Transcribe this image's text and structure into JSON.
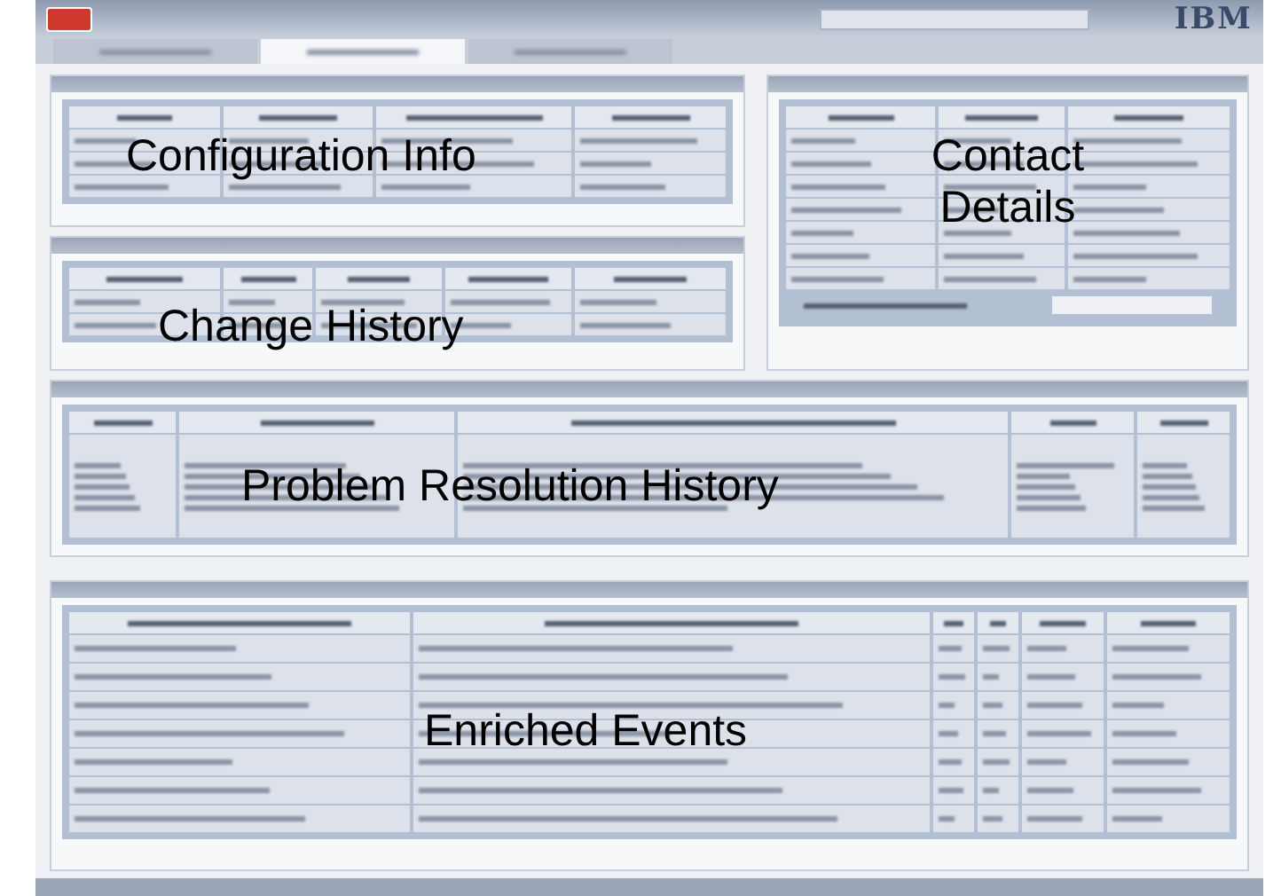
{
  "header": {
    "brand": "IBM"
  },
  "tabs": [
    {
      "selected": false
    },
    {
      "selected": true
    },
    {
      "selected": false
    }
  ],
  "panels": [
    {
      "kind": "config",
      "label": "Configuration Info"
    },
    {
      "kind": "contact",
      "label": "Contact Details"
    },
    {
      "kind": "change",
      "label": "Change History"
    },
    {
      "kind": "problem",
      "label": "Problem Resolution History"
    },
    {
      "kind": "events",
      "label": "Enriched Events"
    }
  ]
}
